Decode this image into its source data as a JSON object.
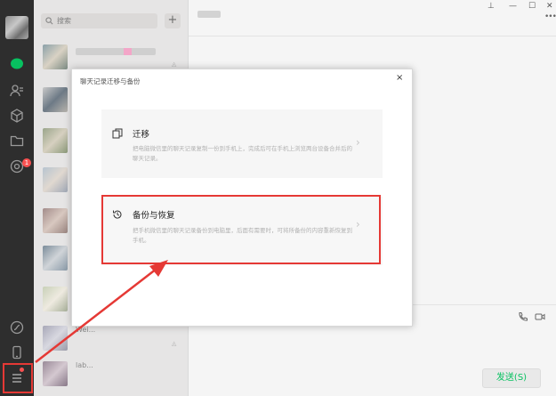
{
  "sidebar": {
    "badge_count": "1",
    "icons": [
      "chat-icon",
      "contacts-icon",
      "favorites-icon",
      "files-icon",
      "moments-icon",
      "mini-program-icon",
      "phone-icon",
      "menu-icon"
    ]
  },
  "chatlist": {
    "search_placeholder": "搜索",
    "plus_label": "+",
    "items": [
      {
        "name": ""
      },
      {
        "name": ""
      },
      {
        "name": ""
      },
      {
        "name": ""
      },
      {
        "name": ""
      },
      {
        "name": ""
      },
      {
        "name": ""
      },
      {
        "name": "Wei..."
      },
      {
        "name": "lab..."
      }
    ]
  },
  "window": {
    "pin_label": "⊥",
    "minimize_label": "—",
    "maximize_label": "☐",
    "close_label": "✕",
    "more_label": "•••"
  },
  "modal": {
    "title": "聊天记录迁移与备份",
    "close_label": "×",
    "migrate": {
      "title": "迁移",
      "desc": "把电脑微信里的聊天记录复制一份到手机上，完成后可在手机上浏览两台设备合并后的聊天记录。"
    },
    "backup": {
      "title": "备份与恢复",
      "desc": "把手机微信里的聊天记录备份到电脑里，后面有需要时，可将所备份的内容重新恢复到手机。"
    }
  },
  "footer": {
    "send_label": "发送(S)"
  },
  "colors": {
    "sidebar_bg": "#2e2e2e",
    "accent_green": "#07c160",
    "annotation_red": "#e53935"
  }
}
